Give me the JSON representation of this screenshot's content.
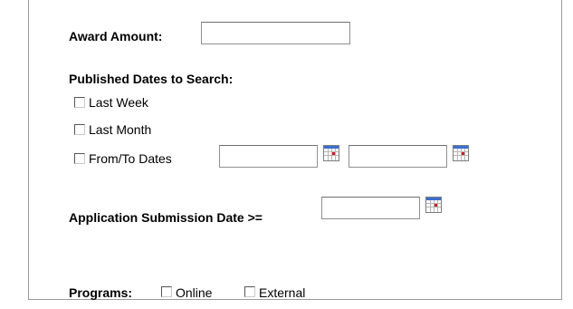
{
  "award_amount": {
    "label": "Award Amount:",
    "value": ""
  },
  "published_dates": {
    "heading": "Published Dates to Search:",
    "options": [
      {
        "label": "Last Week",
        "checked": false
      },
      {
        "label": "Last Month",
        "checked": false
      },
      {
        "label": "From/To Dates",
        "checked": false
      }
    ],
    "from_value": "",
    "to_value": ""
  },
  "application_submission": {
    "label": "Application Submission Date >=",
    "value": ""
  },
  "programs": {
    "label": "Programs:",
    "options": [
      {
        "label": "Online",
        "checked": false
      },
      {
        "label": "External",
        "checked": false
      }
    ]
  },
  "icons": {
    "date_picker": "calendar-icon",
    "checkbox": "checkbox"
  }
}
